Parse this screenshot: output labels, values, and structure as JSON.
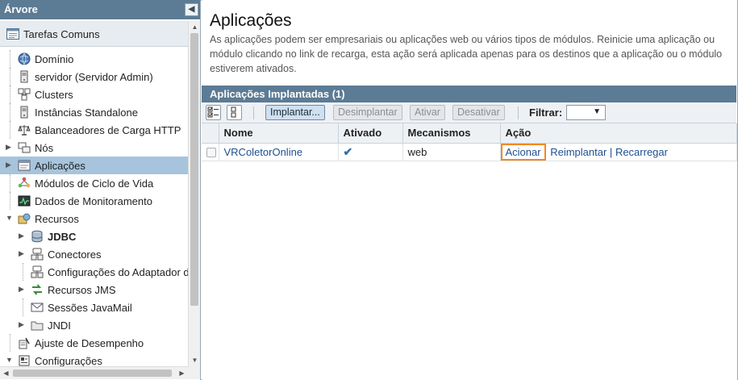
{
  "tree_panel": {
    "title": "Árvore",
    "collapse_glyph": "◀",
    "common_tasks": "Tarefas Comuns",
    "items": [
      {
        "label": "Domínio",
        "icon": "globe-icon",
        "level": 0,
        "expand": "",
        "bold": false,
        "selected": false
      },
      {
        "label": "servidor (Servidor Admin)",
        "icon": "server-icon",
        "level": 0,
        "expand": "",
        "bold": false,
        "selected": false
      },
      {
        "label": "Clusters",
        "icon": "clusters-icon",
        "level": 0,
        "expand": "",
        "bold": false,
        "selected": false
      },
      {
        "label": "Instâncias Standalone",
        "icon": "server-icon",
        "level": 0,
        "expand": "",
        "bold": false,
        "selected": false
      },
      {
        "label": "Balanceadores de Carga HTTP",
        "icon": "balance-icon",
        "level": 0,
        "expand": "",
        "bold": false,
        "selected": false
      },
      {
        "label": "Nós",
        "icon": "nodes-icon",
        "level": 0,
        "expand": "▶",
        "bold": false,
        "selected": false
      },
      {
        "label": "Aplicações",
        "icon": "application-icon",
        "level": 0,
        "expand": "▶",
        "bold": false,
        "selected": true
      },
      {
        "label": "Módulos de Ciclo de Vida",
        "icon": "lifecycle-icon",
        "level": 0,
        "expand": "",
        "bold": false,
        "selected": false
      },
      {
        "label": "Dados de Monitoramento",
        "icon": "monitor-icon",
        "level": 0,
        "expand": "",
        "bold": false,
        "selected": false
      },
      {
        "label": "Recursos",
        "icon": "resources-icon",
        "level": 0,
        "expand": "▼",
        "bold": false,
        "selected": false
      },
      {
        "label": "JDBC",
        "icon": "database-icon",
        "level": 1,
        "expand": "▶",
        "bold": true,
        "selected": false
      },
      {
        "label": "Conectores",
        "icon": "connector-icon",
        "level": 1,
        "expand": "▶",
        "bold": false,
        "selected": false
      },
      {
        "label": "Configurações do Adaptador de",
        "icon": "connector-icon",
        "level": 1,
        "expand": "",
        "bold": false,
        "selected": false
      },
      {
        "label": "Recursos JMS",
        "icon": "jms-icon",
        "level": 1,
        "expand": "▶",
        "bold": false,
        "selected": false
      },
      {
        "label": "Sessões JavaMail",
        "icon": "mail-icon",
        "level": 1,
        "expand": "",
        "bold": false,
        "selected": false
      },
      {
        "label": "JNDI",
        "icon": "jndi-icon",
        "level": 1,
        "expand": "▶",
        "bold": false,
        "selected": false
      },
      {
        "label": "Ajuste de Desempenho",
        "icon": "tuning-icon",
        "level": 0,
        "expand": "",
        "bold": false,
        "selected": false
      },
      {
        "label": "Configurações",
        "icon": "config-icon",
        "level": 0,
        "expand": "▼",
        "bold": false,
        "selected": false
      }
    ]
  },
  "main": {
    "title": "Aplicações",
    "description": "As aplicações podem ser empresariais ou aplicações web ou vários tipos de módulos. Reinicie uma aplicação ou módulo clicando no link de recarga, esta ação será aplicada apenas para os destinos que a aplicação ou o módulo estiverem ativados.",
    "table_title": "Aplicações Implantadas (1)",
    "toolbar": {
      "select_all_icon": "select-all-icon",
      "deselect_all_icon": "deselect-all-icon",
      "implantar": "Implantar...",
      "desimplantar": "Desimplantar",
      "ativar": "Ativar",
      "desativar": "Desativar",
      "filter_label": "Filtrar:",
      "filter_value": ""
    },
    "columns": [
      "Nome",
      "Ativado",
      "Mecanismos",
      "Ação"
    ],
    "rows": [
      {
        "name": "VRColetorOnline",
        "enabled": "✔",
        "engines": "web",
        "actions": {
          "acionar": "Acionar",
          "reimplantar": "Reimplantar",
          "separator": "|",
          "recarregar": "Recarregar"
        }
      }
    ]
  },
  "colors": {
    "header_bg": "#5c7b94",
    "selected_bg": "#a7c4dc",
    "highlight": "#f08a24",
    "link": "#1d4f91"
  }
}
